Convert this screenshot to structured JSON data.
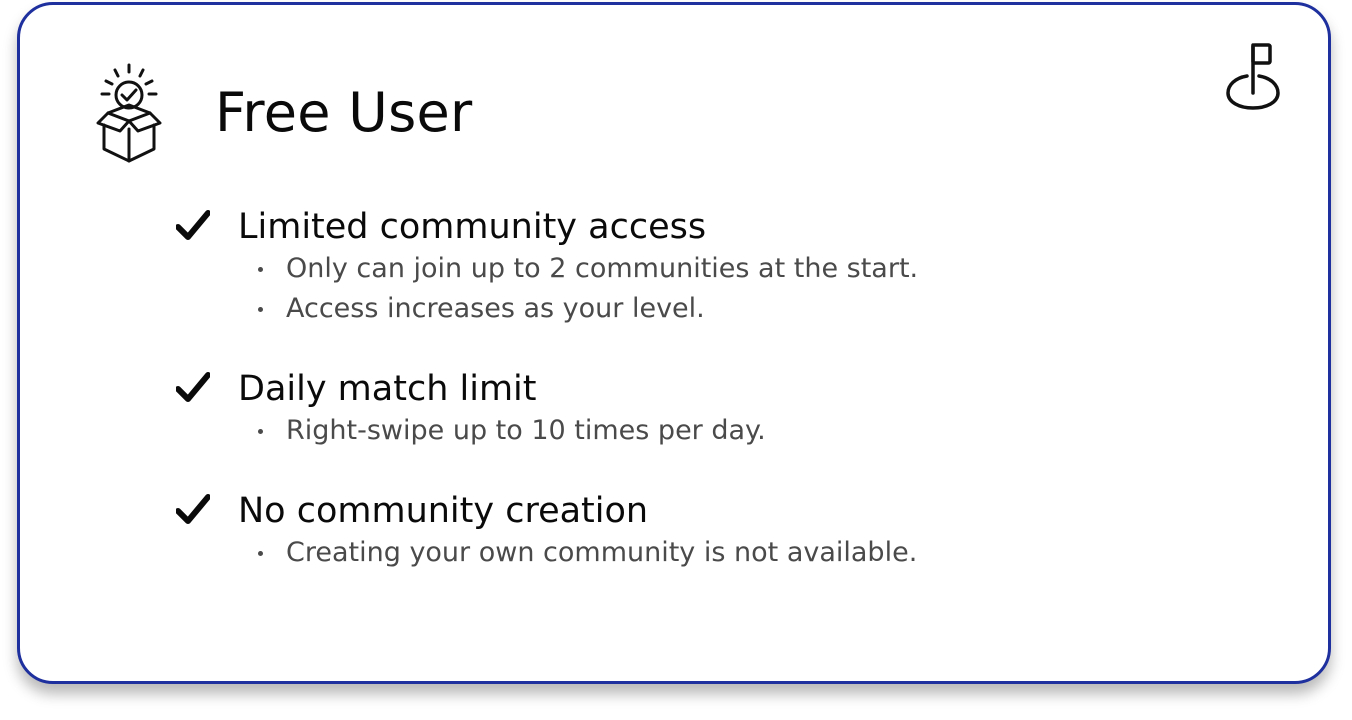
{
  "card": {
    "border_color": "#1e2f9e",
    "plan_icon": "open-box-with-check-badge-icon",
    "title": "Free User",
    "brand_logo_icon": "flag-logo-icon"
  },
  "features": [
    {
      "icon": "checkmark-icon",
      "title": "Limited community access",
      "bullets": [
        "Only can join up to 2 communities at the start.",
        "Access increases as your level."
      ]
    },
    {
      "icon": "checkmark-icon",
      "title": "Daily match limit",
      "bullets": [
        "Right-swipe up to 10 times per day."
      ]
    },
    {
      "icon": "checkmark-icon",
      "title": "No community creation",
      "bullets": [
        "Creating your own community is not available."
      ]
    }
  ]
}
